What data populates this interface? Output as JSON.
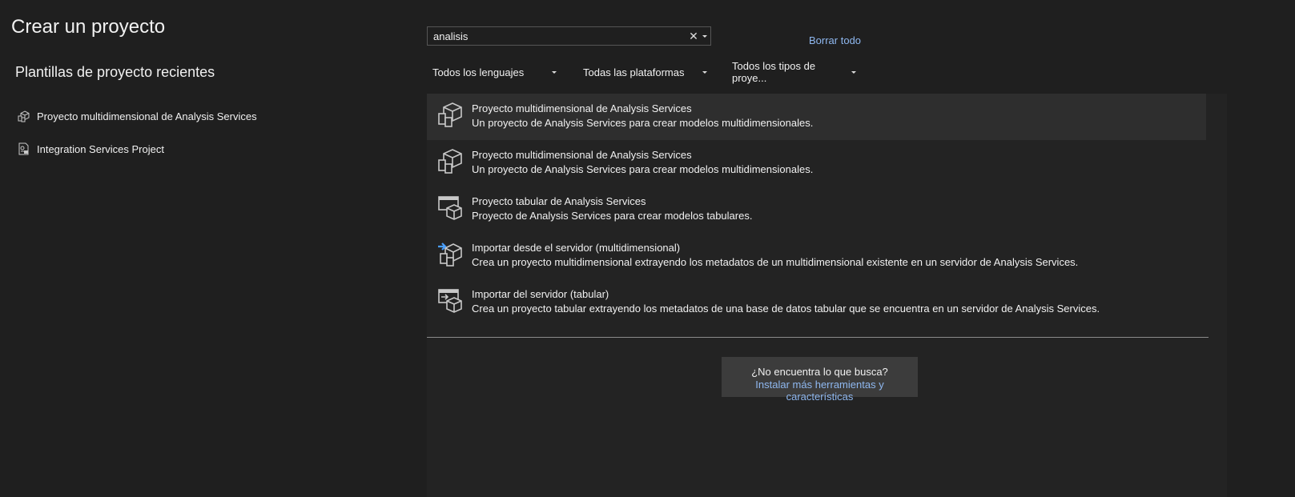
{
  "page": {
    "title": "Crear un proyecto"
  },
  "recent": {
    "heading": "Plantillas de proyecto recientes",
    "items": [
      {
        "label": "Proyecto multidimensional de Analysis Services",
        "icon": "analysis-services-cube-icon"
      },
      {
        "label": "Integration Services Project",
        "icon": "integration-services-icon"
      }
    ]
  },
  "search": {
    "value": "analisis",
    "clear_glyph": "✕"
  },
  "clear_all": "Borrar todo",
  "filters": {
    "language": "Todos los lenguajes",
    "platform": "Todas las plataformas",
    "project_type": "Todos los tipos de proye..."
  },
  "results": [
    {
      "name": "Proyecto multidimensional de Analysis Services",
      "desc": "Un proyecto de Analysis Services para crear modelos multidimensionales.",
      "icon": "multidimensional-cube-icon",
      "selected": true
    },
    {
      "name": "Proyecto multidimensional de Analysis Services",
      "desc": "Un proyecto de Analysis Services para crear modelos multidimensionales.",
      "icon": "multidimensional-cube-icon",
      "selected": false
    },
    {
      "name": "Proyecto tabular de Analysis Services",
      "desc": "Proyecto de Analysis Services para crear modelos tabulares.",
      "icon": "tabular-cube-icon",
      "selected": false
    },
    {
      "name": "Importar desde el servidor (multidimensional)",
      "desc": "Crea un proyecto multidimensional extrayendo los metadatos de un multidimensional existente en un servidor de Analysis Services.",
      "icon": "import-multidimensional-icon",
      "selected": false
    },
    {
      "name": "Importar del servidor (tabular)",
      "desc": "Crea un proyecto tabular extrayendo los metadatos de una base de datos tabular que se encuentra en un servidor de Analysis Services.",
      "icon": "import-tabular-icon",
      "selected": false
    }
  ],
  "not_found": {
    "question": "¿No encuentra lo que busca?",
    "link": "Instalar más herramientas y características"
  },
  "colors": {
    "background": "#1f1f1f",
    "panel": "#232323",
    "selected": "#2e2e2e",
    "link": "#8fb8f0"
  }
}
